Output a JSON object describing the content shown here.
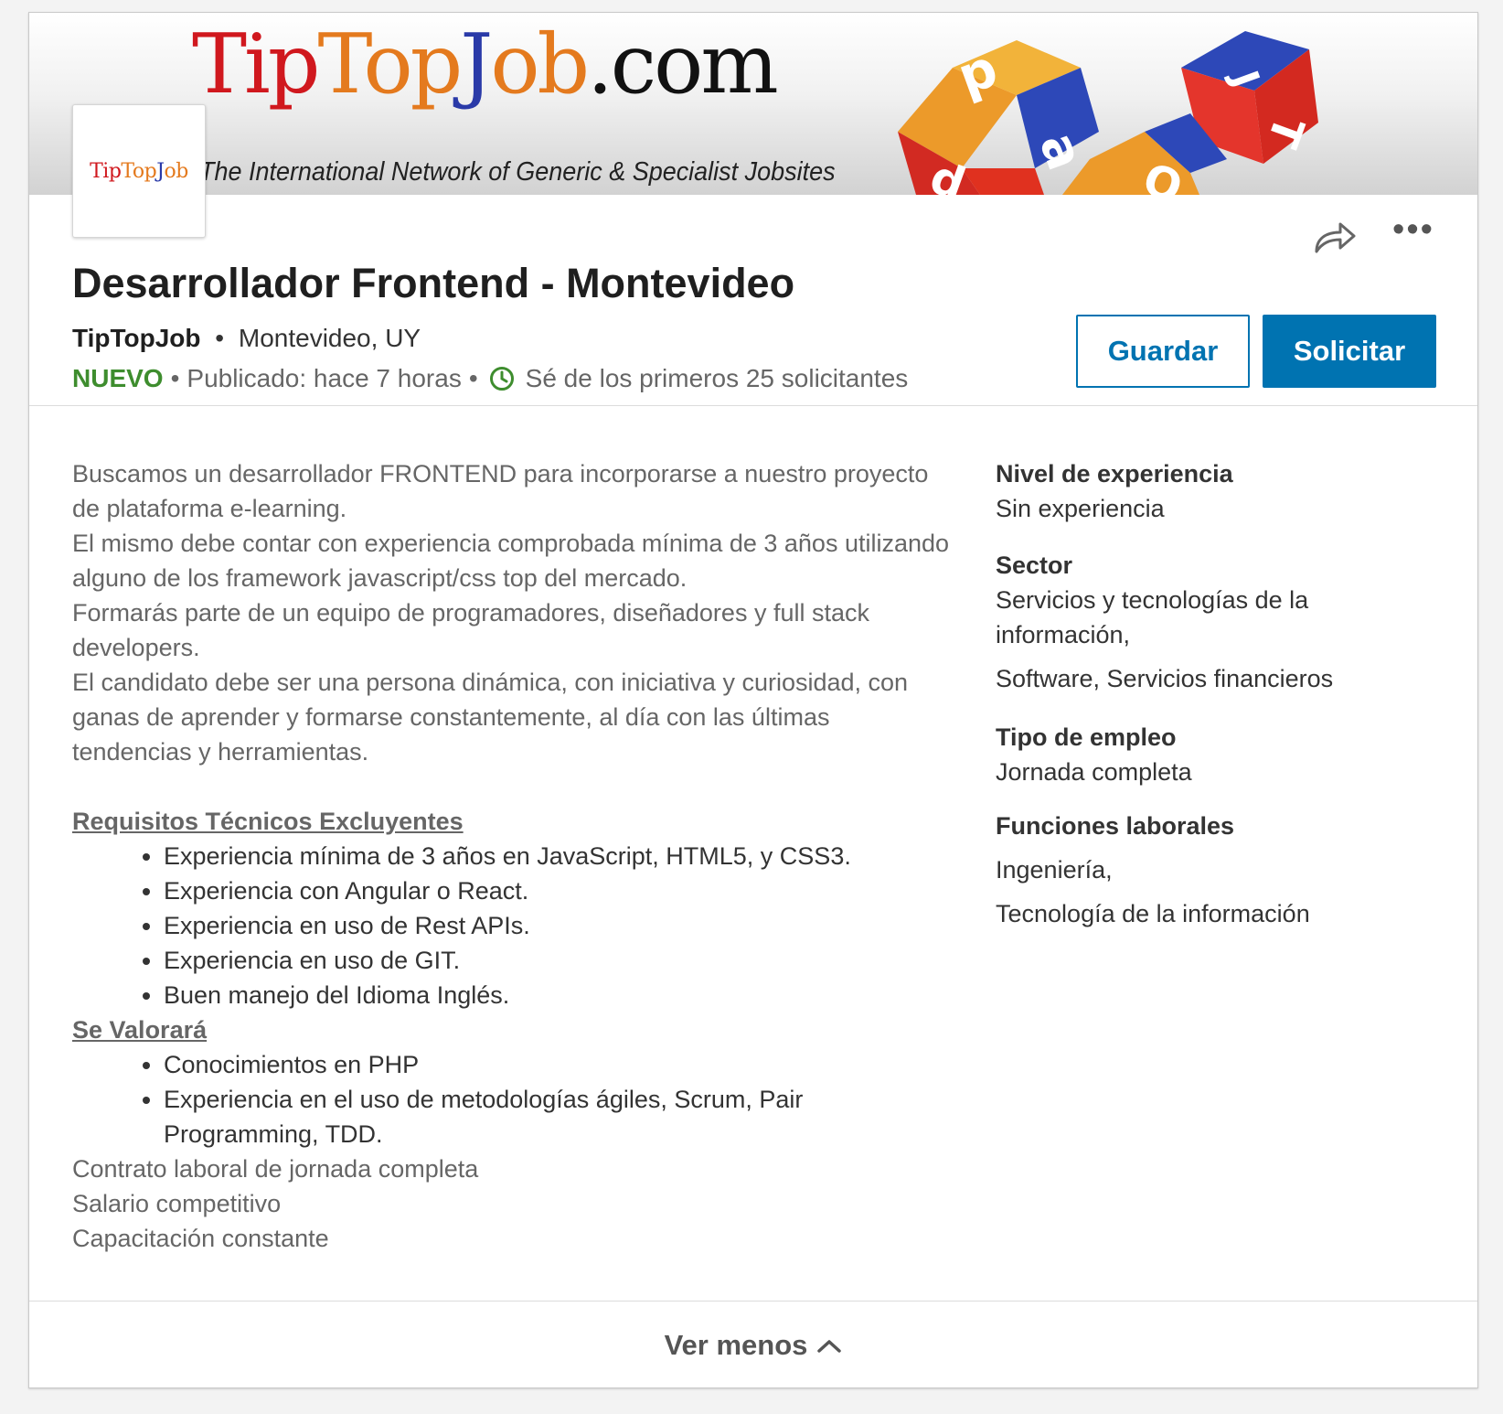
{
  "banner": {
    "brand_parts": [
      "Tip",
      "Top",
      "J",
      "ob",
      ".com"
    ],
    "tagline": "The International Network of Generic & Specialist Jobsites",
    "cube_letters": [
      "p",
      "a",
      "p",
      "T",
      "J",
      "O"
    ]
  },
  "logo": {
    "parts": [
      "Tip",
      "Top",
      "J",
      "ob"
    ]
  },
  "actions": {
    "share_icon": "share-arrow-icon",
    "more_icon": "more-horizontal-icon",
    "more_label": "•••",
    "save_label": "Guardar",
    "apply_label": "Solicitar"
  },
  "job": {
    "title": "Desarrollador Frontend - Montevideo",
    "company": "TipTopJob",
    "separator": "•",
    "location": "Montevideo, UY",
    "new_badge": "NUEVO",
    "posted": "Publicado: hace 7 horas",
    "applicants": "Sé de los primeros 25 solicitantes"
  },
  "description": {
    "intro_lines": [
      "Buscamos un desarrollador FRONTEND para incorporarse a nuestro proyecto de plataforma e-learning.",
      "El mismo debe contar con experiencia comprobada mínima de 3 años utilizando alguno de los framework javascript/css top del mercado.",
      "Formarás parte de un equipo de programadores, diseñadores y full stack developers.",
      "El candidato debe ser una persona dinámica, con iniciativa y curiosidad, con ganas de aprender y formarse constantemente, al día con las últimas tendencias y herramientas."
    ],
    "requirements_title": "Requisitos Técnicos Excluyentes",
    "requirements": [
      "Experiencia mínima de 3 años en JavaScript, HTML5, y CSS3.",
      "Experiencia con Angular o React.",
      "Experiencia en uso de Rest APIs.",
      "Experiencia en uso de GIT.",
      "Buen manejo del Idioma Inglés."
    ],
    "valued_title": "Se Valorará",
    "valued": [
      "Conocimientos en PHP",
      "Experiencia en el uso de metodologías ágiles, Scrum, Pair Programming, TDD."
    ],
    "closing_lines": [
      "Contrato laboral de jornada completa",
      "Salario competitivo",
      "Capacitación constante"
    ]
  },
  "criteria": {
    "level_label": "Nivel de experiencia",
    "level_value": "Sin experiencia",
    "sector_label": "Sector",
    "sector_values": [
      "Servicios y tecnologías de la información,",
      "Software, Servicios financieros"
    ],
    "type_label": "Tipo de empleo",
    "type_value": "Jornada completa",
    "functions_label": "Funciones laborales",
    "functions_values": [
      "Ingeniería,",
      "Tecnología de la información"
    ]
  },
  "footer": {
    "see_less": "Ver menos",
    "chevron_icon": "chevron-up-icon"
  },
  "colors": {
    "brand_red": "#d0181e",
    "brand_orange": "#e47a1e",
    "brand_blue": "#2a3aa8",
    "brand_dark": "#111111",
    "primary": "#0073b1",
    "new_green": "#3e8d2e"
  }
}
